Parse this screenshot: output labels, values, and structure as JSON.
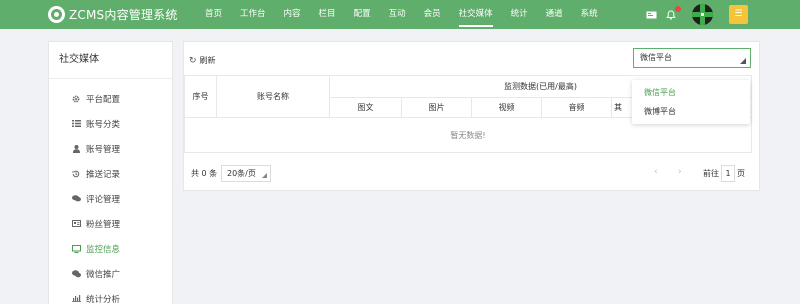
{
  "app": {
    "title": "ZCMS内容管理系统"
  },
  "nav": {
    "items": [
      {
        "label": "首页"
      },
      {
        "label": "工作台"
      },
      {
        "label": "内容"
      },
      {
        "label": "栏目"
      },
      {
        "label": "配置"
      },
      {
        "label": "互动"
      },
      {
        "label": "会员"
      },
      {
        "label": "社交媒体"
      },
      {
        "label": "统计"
      },
      {
        "label": "通道"
      },
      {
        "label": "系统"
      }
    ],
    "active": "社交媒体"
  },
  "header_icons": [
    "id-card-icon",
    "bell-icon",
    "avatar",
    "app-tile-icon"
  ],
  "sidebar": {
    "title": "社交媒体",
    "items": [
      {
        "label": "平台配置",
        "icon": "gear-icon"
      },
      {
        "label": "账号分类",
        "icon": "list-icon"
      },
      {
        "label": "账号管理",
        "icon": "user-icon"
      },
      {
        "label": "推送记录",
        "icon": "history-icon"
      },
      {
        "label": "评论管理",
        "icon": "comments-icon"
      },
      {
        "label": "粉丝管理",
        "icon": "id-card-icon"
      },
      {
        "label": "监控信息",
        "icon": "monitor-icon"
      },
      {
        "label": "微信推广",
        "icon": "wechat-icon"
      },
      {
        "label": "统计分析",
        "icon": "bar-chart-icon"
      }
    ],
    "active": "监控信息"
  },
  "toolbar": {
    "refresh_label": "刷新"
  },
  "platform_select": {
    "value": "微信平台",
    "options": [
      "微信平台",
      "微博平台"
    ]
  },
  "table": {
    "columns": {
      "index": "序号",
      "account_name": "账号名称",
      "group": "监测数据(已用/最高)",
      "sub": [
        "图文",
        "图片",
        "视频",
        "音频",
        "其"
      ]
    },
    "empty_text": "暂无数据!"
  },
  "pagination": {
    "total_text": "共 0 条",
    "page_size": "20条/页",
    "goto_label": "前往",
    "page": "1",
    "page_suffix": "页"
  },
  "colors": {
    "header": "#5fae6b",
    "accent": "#4a9e4f",
    "badge": "#e34b3c"
  }
}
